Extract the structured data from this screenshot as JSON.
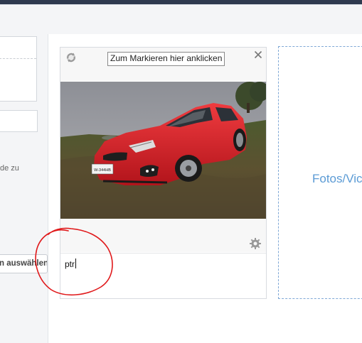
{
  "sidebar": {
    "hint_text": "de zu",
    "select_button_label": "n auswählen"
  },
  "card": {
    "mark_button_label": "Zum Markieren hier anklicken",
    "photo_subject": "red hatchback car on grass",
    "caption_value": "ptr"
  },
  "dropzone": {
    "label": "Fotos/Vic"
  },
  "colors": {
    "accent_blue": "#5b9bd5",
    "annotation_red": "#e0191b",
    "car_red": "#d61f26"
  },
  "icons": [
    "rotate-icon",
    "close-icon",
    "gear-icon"
  ]
}
